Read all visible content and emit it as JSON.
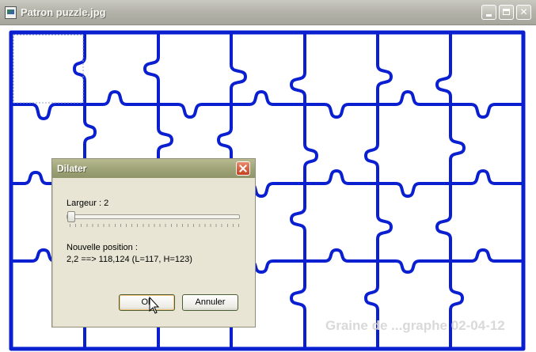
{
  "window": {
    "title": "Patron puzzle.jpg",
    "icon": "image-file-icon"
  },
  "canvas": {
    "watermark": "Graine de ...graphe 02-04-12",
    "border_color": "#0a1fd0",
    "background": "#ffffff"
  },
  "dialog": {
    "title": "Dilater",
    "width_label": "Largeur : 2",
    "slider_value": 2,
    "position_label": "Nouvelle position :",
    "position_value": "2,2 ==> 118,124 (L=117, H=123)",
    "ok_label": "Ok",
    "cancel_label": "Annuler"
  },
  "colors": {
    "title_bar": "#b5b4ab",
    "dialog_title": "#9da277",
    "close_button": "#c4411f"
  }
}
